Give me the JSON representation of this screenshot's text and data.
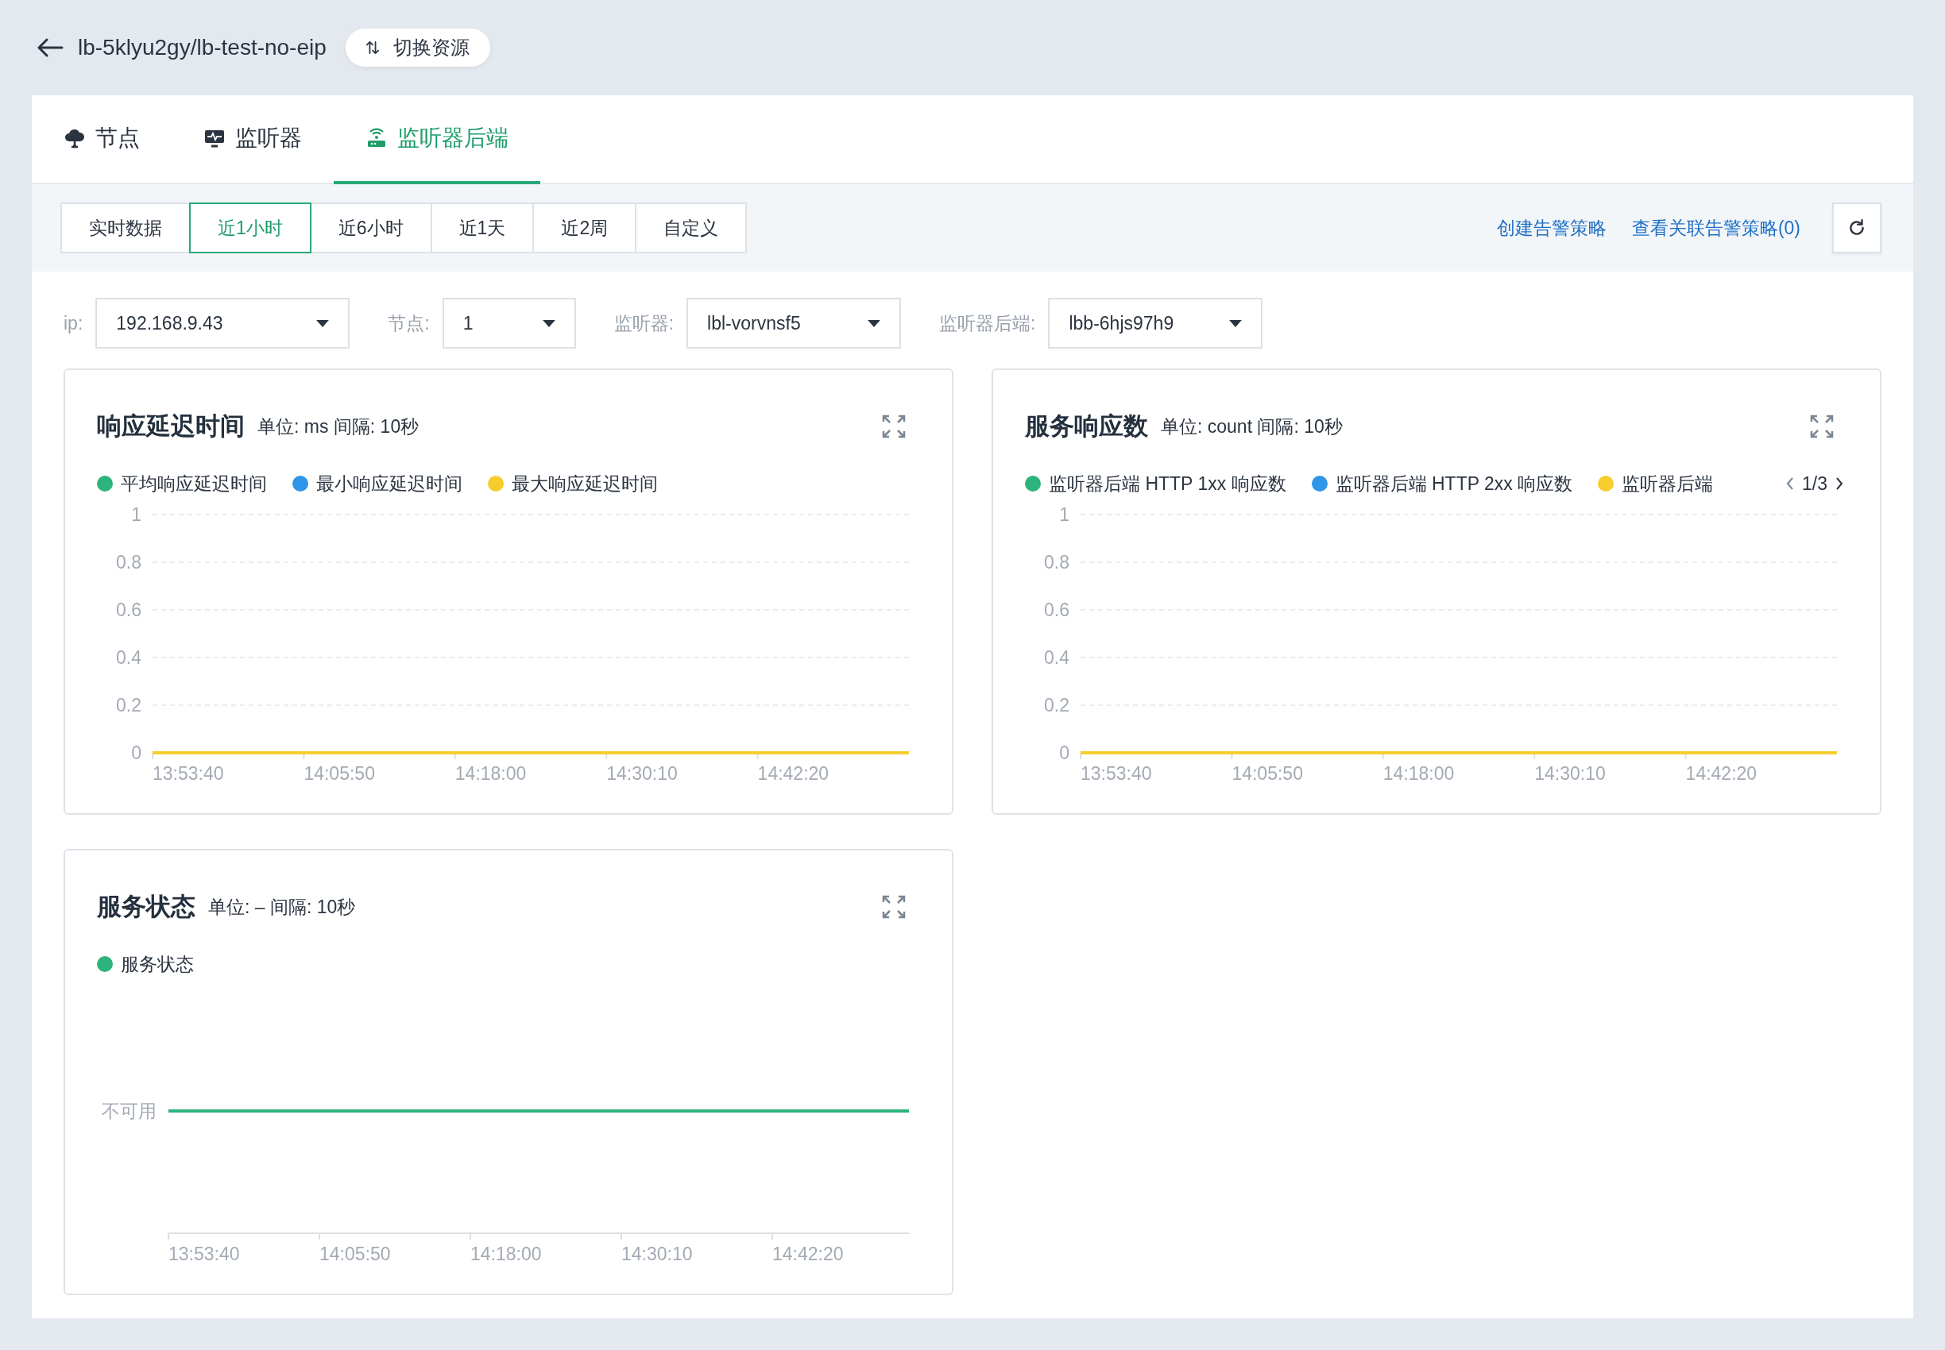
{
  "header": {
    "title": "lb-5klyu2gy/lb-test-no-eip",
    "switch_button": "切换资源"
  },
  "tabs": [
    {
      "label": "节点",
      "selected": false
    },
    {
      "label": "监听器",
      "selected": false
    },
    {
      "label": "监听器后端",
      "selected": true
    }
  ],
  "time_ranges": [
    {
      "label": "实时数据",
      "selected": false
    },
    {
      "label": "近1小时",
      "selected": true
    },
    {
      "label": "近6小时",
      "selected": false
    },
    {
      "label": "近1天",
      "selected": false
    },
    {
      "label": "近2周",
      "selected": false
    },
    {
      "label": "自定义",
      "selected": false
    }
  ],
  "links": [
    "创建告警策略",
    "查看关联告警策略(0)"
  ],
  "filters": [
    {
      "label": "ip:",
      "value": "192.168.9.43"
    },
    {
      "label": "节点:",
      "value": "1"
    },
    {
      "label": "监听器:",
      "value": "lbl-vorvnsf5"
    },
    {
      "label": "监听器后端:",
      "value": "lbb-6hjs97h9"
    }
  ],
  "charts": [
    {
      "kind": "line",
      "title": "响应延迟时间",
      "meta": "单位: ms 间隔: 10秒",
      "chart_data": {
        "type": "line",
        "grid": true,
        "categories": [
          "13:53:40",
          "14:05:50",
          "14:18:00",
          "14:30:10",
          "14:42:20",
          null
        ],
        "ylim": [
          0,
          1
        ],
        "yticks": [
          0,
          0.2,
          0.4,
          0.6,
          0.8,
          1
        ],
        "series": [
          {
            "name": "平均响应延迟时间",
            "color": "#2db47d",
            "values": [
              null,
              null,
              null,
              null,
              null,
              null
            ]
          },
          {
            "name": "最小响应延迟时间",
            "color": "#2e95e8",
            "values": [
              null,
              null,
              null,
              null,
              null,
              null
            ]
          },
          {
            "name": "最大响应延迟时间",
            "color": "#f7cd2e",
            "values": [
              0,
              0,
              0,
              0,
              0,
              0
            ]
          }
        ]
      }
    },
    {
      "kind": "line",
      "title": "服务响应数",
      "meta": "单位: count 间隔: 10秒",
      "pager": "1/3",
      "chart_data": {
        "type": "line",
        "grid": true,
        "categories": [
          "13:53:40",
          "14:05:50",
          "14:18:00",
          "14:30:10",
          "14:42:20",
          null
        ],
        "ylim": [
          0,
          1
        ],
        "yticks": [
          0,
          0.2,
          0.4,
          0.6,
          0.8,
          1
        ],
        "series": [
          {
            "name": "监听器后端 HTTP 1xx 响应数",
            "color": "#2db47d",
            "values": [
              null,
              null,
              null,
              null,
              null,
              null
            ]
          },
          {
            "name": "监听器后端 HTTP 2xx 响应数",
            "color": "#2e95e8",
            "values": [
              null,
              null,
              null,
              null,
              null,
              null
            ]
          },
          {
            "name": "监听器后端",
            "color": "#f7cd2e",
            "values": [
              0,
              0,
              0,
              0,
              0,
              0
            ]
          }
        ]
      }
    },
    {
      "kind": "status",
      "title": "服务状态",
      "meta": "单位: – 间隔: 10秒",
      "legend": [
        {
          "label": "服务状态",
          "color": "#2db47d"
        }
      ],
      "y_label": "不可用",
      "x_labels": [
        "13:53:40",
        "14:05:50",
        "14:18:00",
        "14:30:10",
        "14:42:20"
      ]
    }
  ]
}
